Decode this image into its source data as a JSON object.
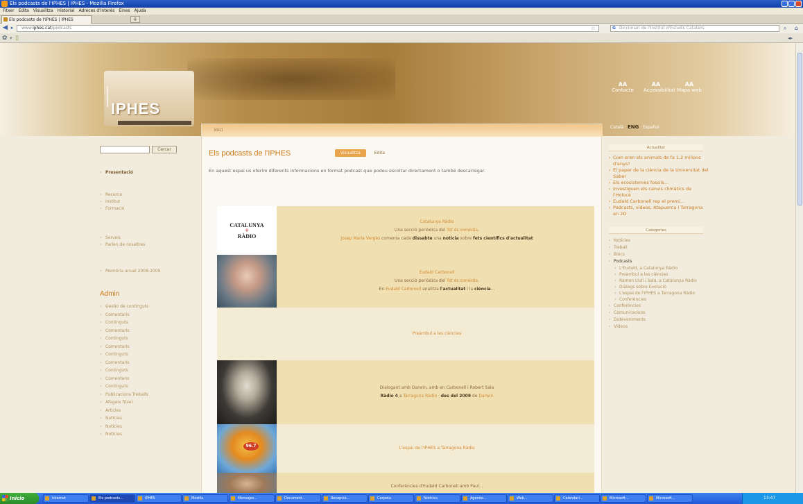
{
  "window": {
    "title": "Els podcasts de l'IPHES | IPHES - Mozilla Firefox"
  },
  "menu": [
    "Fitxer",
    "Edita",
    "Visualitza",
    "Historial",
    "Adreces d'interès",
    "Eines",
    "Ajuda"
  ],
  "tab": {
    "label": "Els podcasts de l'IPHES | IPHES",
    "new_tab": "+"
  },
  "nav": {
    "url_prefix": "www.",
    "url_domain": "iphes.cat",
    "url_path": "/podcasts",
    "search_engine": "G",
    "search_placeholder": "Diccionari de l'Institut d'Estudis Catalans"
  },
  "banner": {
    "logo": "IPHES",
    "links": [
      {
        "top": "AA",
        "label": "Contacte"
      },
      {
        "top": "AA",
        "label": "Accessibilitat"
      },
      {
        "top": "AA",
        "label": "Mapa web"
      }
    ],
    "lang": {
      "pre": "Català · ",
      "active": "ENG",
      "post": " · Español"
    }
  },
  "content": {
    "breadcrumb": "Inici",
    "title": "Els podcasts de l'IPHES",
    "tabs": [
      "Visualitza",
      "Edita"
    ],
    "intro": "En aquest espai us oferim diferents informacions en format podcast que podeu escoltar directament o també descarregar.",
    "podcasts": [
      {
        "lines": [
          [
            {
              "t": "Catalunya Ràdio",
              "c": "orange"
            }
          ],
          [
            {
              "t": "Una secció periòdica del "
            },
            {
              "t": "Tot és comèdia",
              "c": "orange"
            },
            {
              "t": "."
            }
          ],
          [
            {
              "t": "Josep Maria Vergès",
              "c": "orange"
            },
            {
              "t": " comenta cada "
            },
            {
              "t": "dissabte",
              "c": "bold"
            },
            {
              "t": " una "
            },
            {
              "t": "notícia",
              "c": "bold"
            },
            {
              "t": " sobre "
            },
            {
              "t": "fets científics d'actualitat",
              "c": "bold"
            }
          ]
        ]
      },
      {
        "lines": [
          [
            {
              "t": "Eudald Carbonell",
              "c": "orange"
            }
          ],
          [
            {
              "t": "Una secció periòdica del "
            },
            {
              "t": "Tot és comèdia",
              "c": "orange"
            },
            {
              "t": "."
            }
          ],
          [
            {
              "t": "En "
            },
            {
              "t": "Eudald Carbonell",
              "c": "orange"
            },
            {
              "t": " analitza "
            },
            {
              "t": "l'actualitat",
              "c": "bold"
            },
            {
              "t": " i la "
            },
            {
              "t": "ciència",
              "c": "bold"
            },
            {
              "t": "..."
            }
          ]
        ]
      },
      {
        "lines": [
          [
            {
              "t": "Preàmbul a les ciències",
              "c": "orange"
            }
          ]
        ]
      },
      {
        "lines": [
          [
            {
              "t": "Dialogant amb Darwin, amb en Carbonell i Robert Sala"
            }
          ],
          [
            {
              "t": "Ràdio 4",
              "c": "bold"
            },
            {
              "t": " a "
            },
            {
              "t": "Tarragona Ràdio",
              "c": "orange"
            },
            {
              "t": " · "
            },
            {
              "t": "des del 2009",
              "c": "bold"
            },
            {
              "t": " de "
            },
            {
              "t": "Darwin",
              "c": "orange"
            }
          ]
        ]
      },
      {
        "lines": [
          [
            {
              "t": "L'espai de l'IPHES a Tarragona Ràdio",
              "c": "orange"
            }
          ]
        ]
      },
      {
        "lines": [
          [
            {
              "t": "Conferències d'Eudald Carbonell amb Paul..."
            }
          ]
        ]
      }
    ],
    "thumb_text": {
      "line1": "CATALUNYA",
      "line2": "+",
      "line3": "RÀDIO",
      "badge": "96.7"
    }
  },
  "left": {
    "search_button": "Cercar",
    "nav_top": "Presentació",
    "nav_group1": [
      "Recerca",
      "Institut",
      "Formació"
    ],
    "nav_group2": [
      "Serveis",
      "Parlen de nosaltres"
    ],
    "nav_group3": [
      "Memòria anual 2008-2009"
    ],
    "admin_title": "Admin",
    "admin_items": [
      "Gestió de continguts",
      "Comentaris",
      "Continguts",
      "Comentaris",
      "Continguts",
      "Comentaris",
      "Continguts",
      "Comentaris",
      "Continguts",
      "Comentaris",
      "Continguts",
      "Publicacions Treballs",
      "Afegeix fitxer",
      "Articles",
      "Notícies",
      "Notícies",
      "Notícies"
    ]
  },
  "right": {
    "news_title": "Actualitat",
    "news": [
      "Com eren els animals de fa 1,2 milions d'anys?",
      "El paper de la ciència de la Universitat del Saber",
      "Els ecosistemes fossils...",
      "Investiguen els canvis climàtics de l'Holocè",
      "Eudald Carbonell rep el premi...",
      "Podcasts, vídeos, Atapuerca i Tarragona en 2D"
    ],
    "cat_title": "Categories",
    "cats": [
      {
        "t": "Notícies"
      },
      {
        "t": "Treball"
      },
      {
        "t": "Blocs"
      },
      {
        "t": "Podcasts",
        "dark": true
      },
      {
        "t": "L'Eudald, a Catalunya Ràdio",
        "sub": true
      },
      {
        "t": "Preàmbul a les ciències",
        "sub": true
      },
      {
        "t": "Ramon Llull i Sala, a Catalunya Ràdio",
        "sub": true
      },
      {
        "t": "Diàlegs sobre Evolució",
        "sub": true
      },
      {
        "t": "L'espai de l'IPHES a Tarragona Ràdio",
        "sub": true
      },
      {
        "t": "Conferències",
        "sub": true
      },
      {
        "t": "Conferències"
      },
      {
        "t": "Comunicacions"
      },
      {
        "t": "Esdeveniments"
      },
      {
        "t": "Vídeos"
      }
    ]
  },
  "taskbar": {
    "start": "Inicio",
    "tasks": [
      "Internet",
      "Els podcasts...",
      "IPHES",
      "Mozilla",
      "Mensajes...",
      "Document...",
      "Recepció...",
      "Carpeta",
      "Notícies",
      "Agenda...",
      "Web...",
      "Calendari...",
      "Microsoft...",
      "Microsoft..."
    ],
    "clock": "13:47"
  }
}
